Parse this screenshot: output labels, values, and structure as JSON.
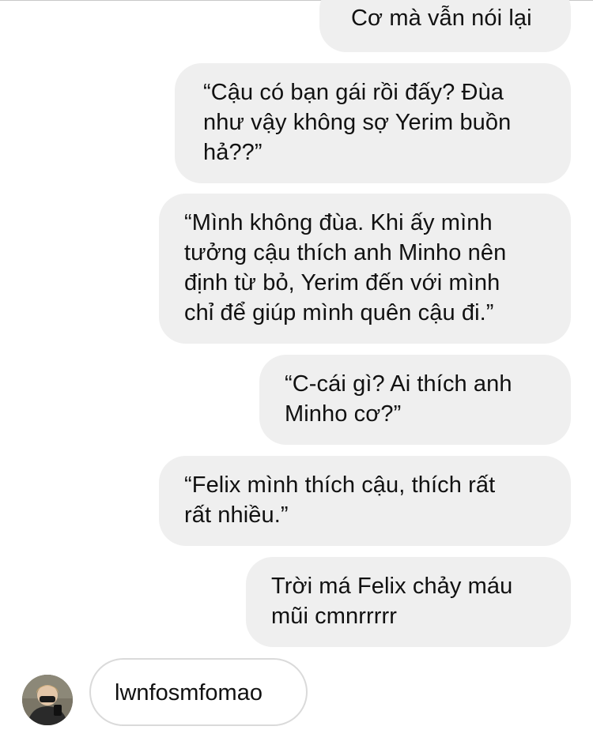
{
  "conversation": {
    "outgoing_messages": [
      {
        "text": "Cơ mà vẫn nói lại"
      },
      {
        "text": "“Cậu có bạn gái rồi đấy? Đùa\nnhư vậy không sợ Yerim buồn\nhả??”"
      },
      {
        "text": "“Mình không đùa. Khi ấy mình\ntưởng cậu thích anh Minho nên\nđịnh từ bỏ, Yerim đến với mình\nchỉ để giúp mình quên cậu đi.”"
      },
      {
        "text": "“C-cái gì? Ai thích anh\nMinho cơ?”"
      },
      {
        "text": " “Felix mình thích cậu, thích rất\nrất nhiều.”"
      },
      {
        "text": " Trời má Felix chảy máu\nmũi cmnrrrrr"
      }
    ],
    "incoming_message": {
      "text": "lwnfosmfomao"
    },
    "avatar_icon": "user-avatar-icon",
    "colors": {
      "outgoing_bubble": "#efefef",
      "incoming_border": "#dadada",
      "text": "#111111"
    }
  }
}
